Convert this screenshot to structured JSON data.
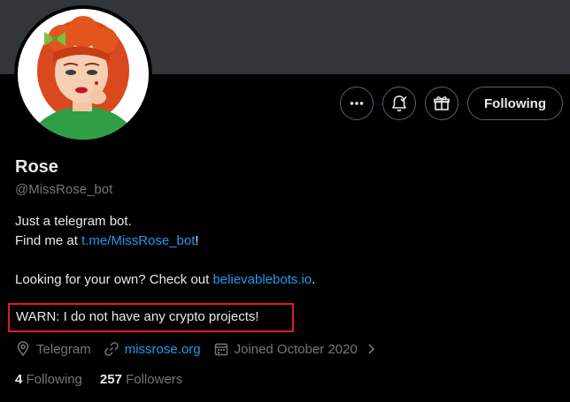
{
  "profile": {
    "name": "Rose",
    "handle": "@MissRose_bot",
    "bio": {
      "line1": "Just a telegram bot.",
      "line2_prefix": "Find me at ",
      "line2_link": "t.me/MissRose_bot",
      "line2_suffix": "!",
      "line3_prefix": "Looking for your own? Check out ",
      "line3_link": "believablebots.io",
      "line3_suffix": "."
    },
    "warning": "WARN: I do not have any crypto projects!",
    "location": "Telegram",
    "website": "missrose.org",
    "joined": "Joined October 2020",
    "following_count": "4",
    "following_label": "Following",
    "followers_count": "257",
    "followers_label": "Followers"
  },
  "actions": {
    "more_icon": "more-icon",
    "notify_icon": "bell-check-icon",
    "gift_icon": "gift-icon",
    "follow_label": "Following"
  },
  "colors": {
    "accent": "#1d9bf0",
    "muted": "#71767b",
    "warn_border": "#e01b24",
    "banner": "#333639"
  }
}
